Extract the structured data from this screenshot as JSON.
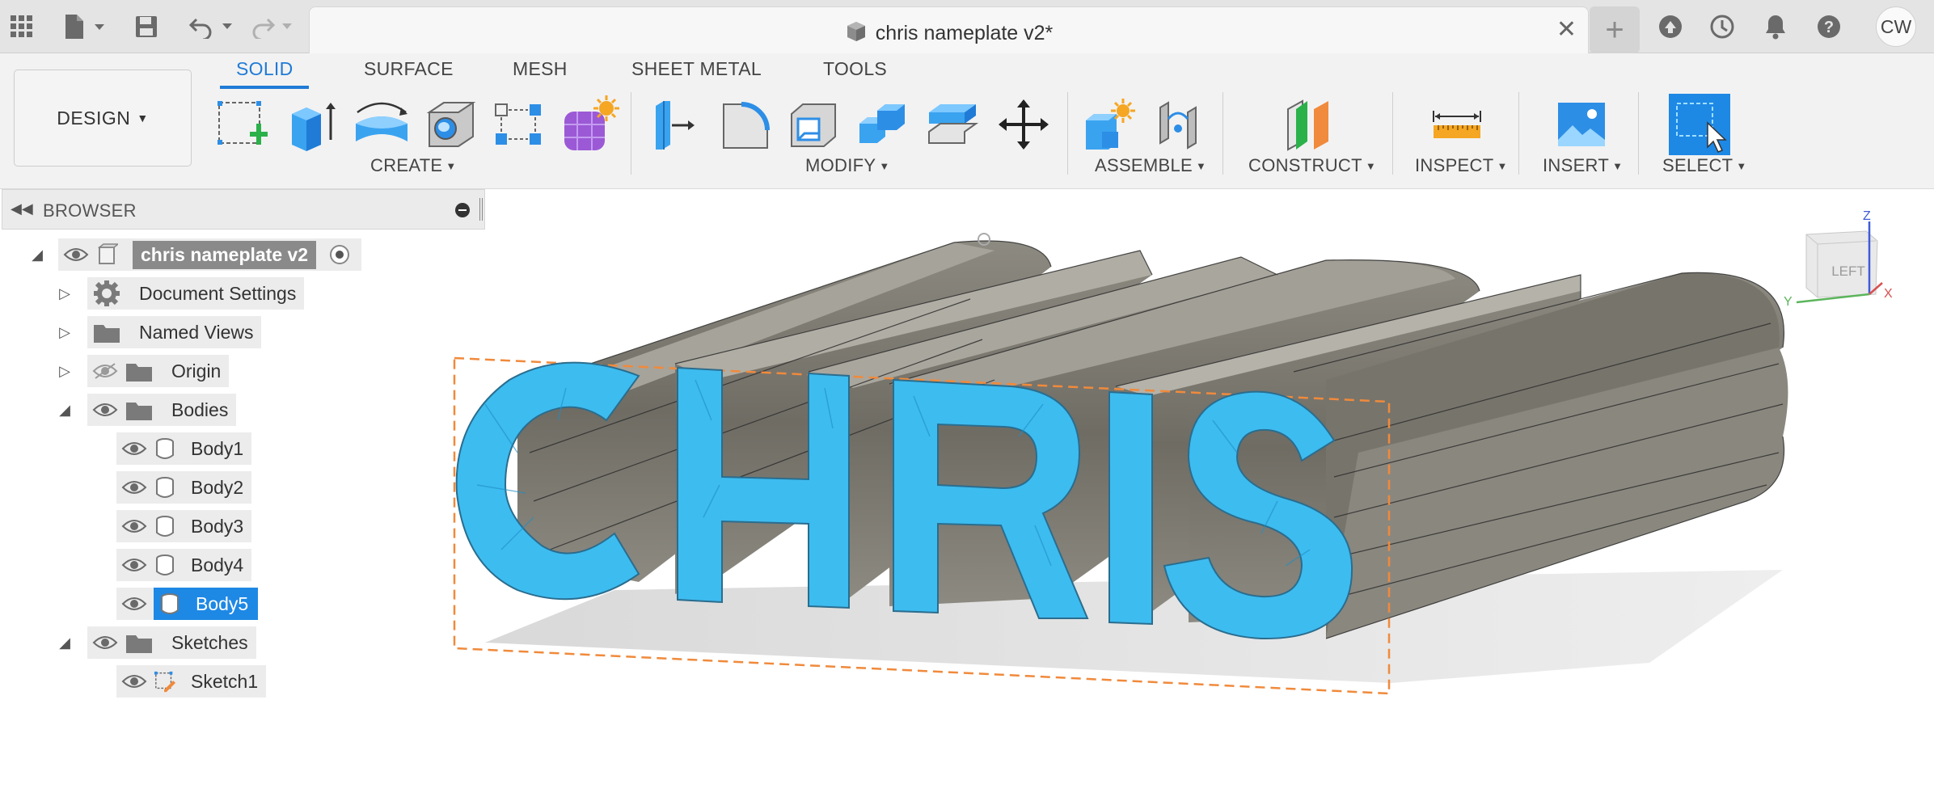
{
  "app": {
    "accent": "#1f7bd6",
    "selection_blue": "#1e88e5",
    "model_color": "#3dbcf0"
  },
  "titlebar": {
    "doc_title": "chris nameplate v2*",
    "close_glyph": "✕",
    "new_tab_glyph": "+",
    "user_initials": "CW",
    "icons": [
      "apps-grid-icon",
      "file-icon",
      "save-icon",
      "undo-icon",
      "redo-icon",
      "extensions-icon",
      "job-status-icon",
      "notifications-icon",
      "help-icon"
    ]
  },
  "toolbar": {
    "workspace_button": "DESIGN",
    "tabs": [
      "SOLID",
      "SURFACE",
      "MESH",
      "SHEET METAL",
      "TOOLS"
    ],
    "active_tab": "SOLID",
    "groups": {
      "create": "CREATE",
      "modify": "MODIFY",
      "assemble": "ASSEMBLE",
      "construct": "CONSTRUCT",
      "inspect": "INSPECT",
      "insert": "INSERT",
      "select": "SELECT"
    }
  },
  "browser": {
    "title": "BROWSER",
    "root": "chris nameplate v2",
    "items": {
      "document_settings": "Document Settings",
      "named_views": "Named Views",
      "origin": "Origin",
      "bodies": "Bodies",
      "sketches": "Sketches"
    },
    "bodies": [
      "Body1",
      "Body2",
      "Body3",
      "Body4",
      "Body5"
    ],
    "selected_body": "Body5",
    "sketches": [
      "Sketch1"
    ]
  },
  "viewport": {
    "text": "CHRIS",
    "viewcube_face": "LEFT",
    "axes": {
      "z": "Z",
      "y": "Y",
      "x": "X"
    }
  }
}
